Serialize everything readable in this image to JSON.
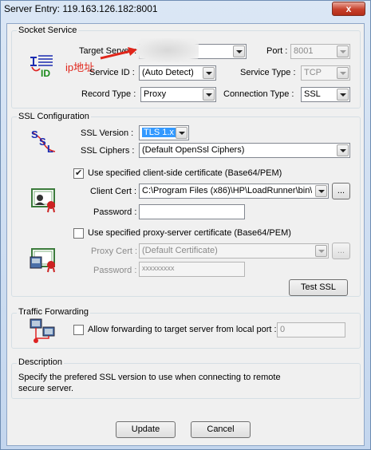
{
  "window": {
    "title": "Server Entry: 119.163.126.182:8001",
    "close_label": "x"
  },
  "annotation": {
    "text": "ip地址",
    "color": "#e0261b"
  },
  "socket_service": {
    "title": "Socket Service",
    "target_server_label": "Target Server :",
    "port_label": "Port :",
    "port_value": "8001",
    "service_id_label": "Service ID :",
    "service_id_value": "(Auto Detect)",
    "service_type_label": "Service Type :",
    "service_type_value": "TCP",
    "record_type_label": "Record Type :",
    "record_type_value": "Proxy",
    "connection_type_label": "Connection Type :",
    "connection_type_value": "SSL",
    "id_icon_text": "ID"
  },
  "ssl_configuration": {
    "title": "SSL Configuration",
    "ssl_version_label": "SSL Version :",
    "ssl_version_value": "TLS 1.x",
    "ssl_ciphers_label": "SSL Ciphers :",
    "ssl_ciphers_value": "(Default OpenSsl Ciphers)",
    "ssl_icon_letters": [
      "S",
      "S",
      "L"
    ],
    "client_cert_checkbox_label": "Use specified client-side certificate (Base64/PEM)",
    "client_cert_label": "Client Cert :",
    "client_cert_value": "C:\\Program Files (x86)\\HP\\LoadRunner\\bin\\R",
    "client_browse_label": "...",
    "password_label": "Password :",
    "password_value": "",
    "proxy_cert_checkbox_label": "Use specified proxy-server certificate (Base64/PEM)",
    "proxy_cert_label": "Proxy Cert :",
    "proxy_cert_value": "(Default Certificate)",
    "proxy_browse_label": "...",
    "proxy_password_label": "Password :",
    "proxy_password_value": "xxxxxxxxx",
    "test_ssl_label": "Test SSL"
  },
  "traffic_forwarding": {
    "title": "Traffic Forwarding",
    "allow_checkbox_label": "Allow forwarding to target server from local port :",
    "local_port_value": "0"
  },
  "description": {
    "title": "Description",
    "line1": "Specify the prefered SSL version to use when connecting to remote",
    "line2": "secure server."
  },
  "buttons": {
    "update_label": "Update",
    "cancel_label": "Cancel"
  }
}
